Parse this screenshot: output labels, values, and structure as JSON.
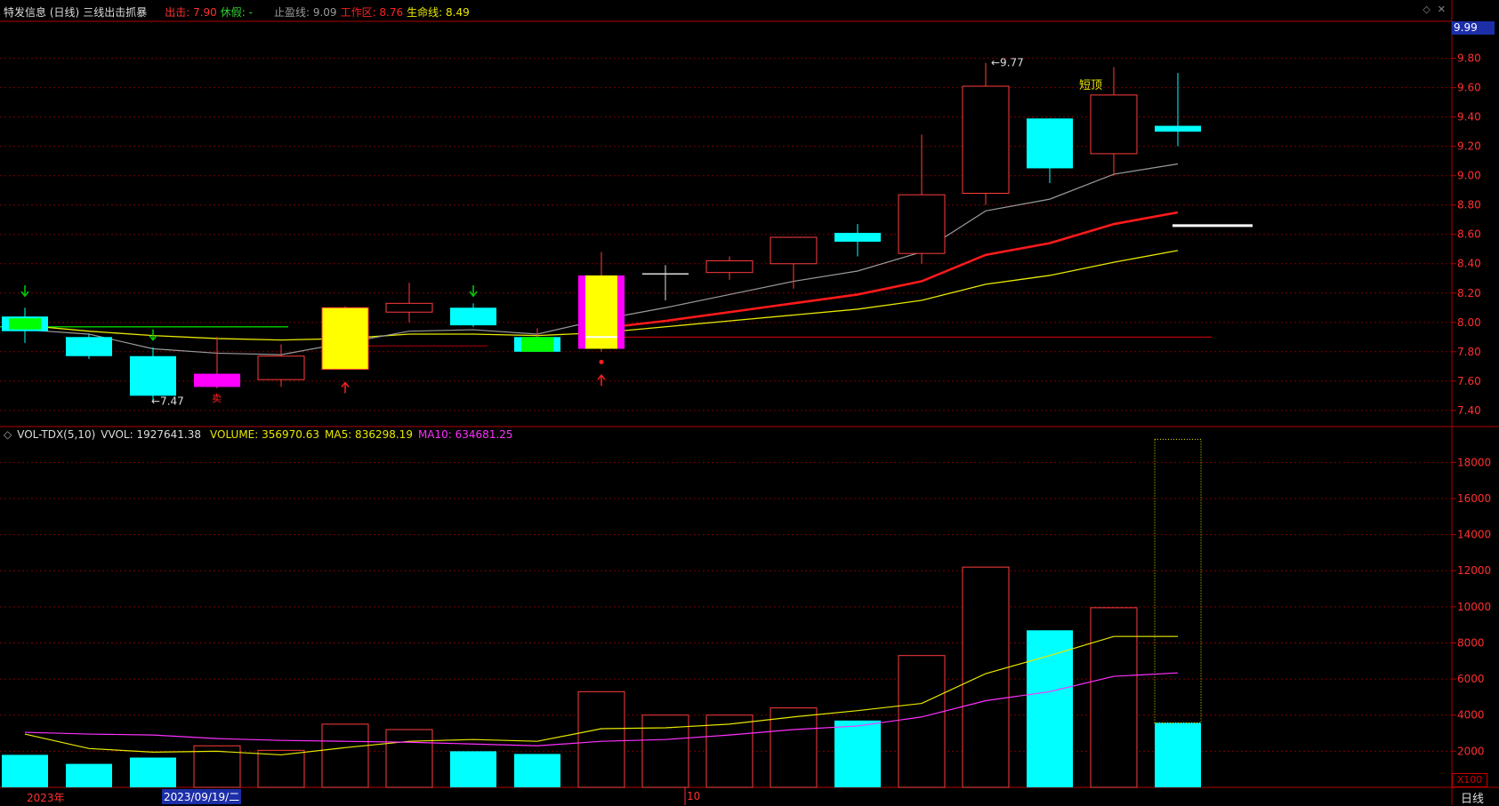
{
  "header": {
    "stock": "特发信息 (日线)",
    "indicator": "三线出击抓暴",
    "items": [
      {
        "label": "出击: 7.90",
        "color": "#ff3030"
      },
      {
        "label": "休假: -",
        "color": "#30d030"
      },
      {
        "label": "止盈线: 9.09",
        "color": "#9a9a9a"
      },
      {
        "label": "工作区: 8.76",
        "color": "#ff2020"
      },
      {
        "label": "生命线: 8.49",
        "color": "#e8e800"
      }
    ]
  },
  "window_icons": [
    "◇",
    "✕"
  ],
  "current_price_tag": "9.99",
  "annotations": {
    "high_label": "9.77",
    "low_label": "7.47",
    "short_top": "短顶",
    "sell_mark": "卖"
  },
  "volume_header": {
    "title": "VOL-TDX(5,10)",
    "vvol": "VVOL: 1927641.38",
    "volume": "VOLUME: 356970.63",
    "ma5": "MA5: 836298.19",
    "ma10": "MA10: 634681.25"
  },
  "volume_multiplier": "X100",
  "date_axis": {
    "year": "2023年",
    "cursor_date": "2023/09/19/二",
    "month": "10"
  },
  "period": "日线",
  "colors": {
    "up": "#ff3c3c",
    "down": "#00ffff",
    "yellow": "#ffff00",
    "magenta": "#ff00ff",
    "green": "#00ff00",
    "grid": "#7a0000"
  },
  "chart_data": {
    "type": "candlestick",
    "price_axis": {
      "ticks": [
        7.4,
        7.6,
        7.8,
        8.0,
        8.2,
        8.4,
        8.6,
        8.8,
        9.0,
        9.2,
        9.4,
        9.6,
        9.8
      ],
      "labels": [
        "7.40",
        "7.60",
        "7.80",
        "8.00",
        "8.20",
        "8.40",
        "8.60",
        "8.80",
        "9.00",
        "9.20",
        "9.40",
        "9.60",
        "9.80"
      ],
      "range": [
        7.29,
        10.04
      ]
    },
    "volume_axis": {
      "ticks": [
        2000,
        4000,
        6000,
        8000,
        10000,
        12000,
        14000,
        16000,
        18000
      ],
      "labels": [
        "2000",
        "4000",
        "6000",
        "8000",
        "10000",
        "12000",
        "14000",
        "16000",
        "18000"
      ],
      "range": [
        0,
        19100
      ]
    },
    "candles": [
      {
        "o": 8.04,
        "h": 8.1,
        "l": 7.86,
        "c": 7.94,
        "style": "down"
      },
      {
        "o": 7.9,
        "h": 7.92,
        "l": 7.75,
        "c": 7.77,
        "style": "down"
      },
      {
        "o": 7.77,
        "h": 7.83,
        "l": 7.47,
        "c": 7.5,
        "style": "down"
      },
      {
        "o": 7.56,
        "h": 7.9,
        "l": 7.55,
        "c": 7.65,
        "style": "magenta"
      },
      {
        "o": 7.61,
        "h": 7.85,
        "l": 7.56,
        "c": 7.77,
        "style": "up"
      },
      {
        "o": 7.68,
        "h": 8.11,
        "l": 7.68,
        "c": 8.1,
        "style": "yellow"
      },
      {
        "o": 8.07,
        "h": 8.27,
        "l": 8.0,
        "c": 8.13,
        "style": "up"
      },
      {
        "o": 8.1,
        "h": 8.13,
        "l": 7.97,
        "c": 7.98,
        "style": "down"
      },
      {
        "o": 7.9,
        "h": 7.96,
        "l": 7.8,
        "c": 7.8,
        "style": "green"
      },
      {
        "o": 7.82,
        "h": 8.48,
        "l": 7.8,
        "c": 8.32,
        "style": "yellow"
      },
      {
        "o": 8.33,
        "h": 8.39,
        "l": 8.15,
        "c": 8.33,
        "style": "doji"
      },
      {
        "o": 8.34,
        "h": 8.45,
        "l": 8.29,
        "c": 8.42,
        "style": "up"
      },
      {
        "o": 8.4,
        "h": 8.58,
        "l": 8.23,
        "c": 8.58,
        "style": "up"
      },
      {
        "o": 8.61,
        "h": 8.67,
        "l": 8.45,
        "c": 8.55,
        "style": "down"
      },
      {
        "o": 8.47,
        "h": 9.28,
        "l": 8.4,
        "c": 8.87,
        "style": "up"
      },
      {
        "o": 8.88,
        "h": 9.77,
        "l": 8.8,
        "c": 9.61,
        "style": "up"
      },
      {
        "o": 9.39,
        "h": 9.39,
        "l": 8.95,
        "c": 9.05,
        "style": "down"
      },
      {
        "o": 9.15,
        "h": 9.74,
        "l": 9.0,
        "c": 9.55,
        "style": "up"
      },
      {
        "o": 9.34,
        "h": 9.7,
        "l": 9.2,
        "c": 9.3,
        "style": "down"
      }
    ],
    "ma_gray": [
      7.95,
      7.92,
      7.82,
      7.79,
      7.78,
      7.86,
      7.94,
      7.95,
      7.92,
      8.02,
      8.1,
      8.19,
      8.28,
      8.35,
      8.48,
      8.76,
      8.84,
      9.01,
      9.08
    ],
    "ma_red": [
      null,
      null,
      null,
      null,
      null,
      null,
      null,
      null,
      null,
      7.96,
      8.01,
      8.07,
      8.13,
      8.19,
      8.28,
      8.46,
      8.54,
      8.67,
      8.75
    ],
    "ma_yellow": [
      7.98,
      7.94,
      7.91,
      7.89,
      7.88,
      7.89,
      7.92,
      7.92,
      7.91,
      7.93,
      7.97,
      8.01,
      8.05,
      8.09,
      8.15,
      8.26,
      8.32,
      8.41,
      8.49
    ],
    "volumes": [
      {
        "v": 1800,
        "style": "down"
      },
      {
        "v": 1300,
        "style": "down"
      },
      {
        "v": 1650,
        "style": "down"
      },
      {
        "v": 2300,
        "style": "up"
      },
      {
        "v": 2050,
        "style": "up"
      },
      {
        "v": 3500,
        "style": "up"
      },
      {
        "v": 3200,
        "style": "up"
      },
      {
        "v": 2000,
        "style": "down"
      },
      {
        "v": 1850,
        "style": "down"
      },
      {
        "v": 5300,
        "style": "up"
      },
      {
        "v": 4000,
        "style": "up"
      },
      {
        "v": 4000,
        "style": "up"
      },
      {
        "v": 4400,
        "style": "up"
      },
      {
        "v": 3700,
        "style": "down"
      },
      {
        "v": 7300,
        "style": "up"
      },
      {
        "v": 12200,
        "style": "up"
      },
      {
        "v": 8700,
        "style": "down"
      },
      {
        "v": 9950,
        "style": "up"
      },
      {
        "v": 3570,
        "style": "down"
      }
    ],
    "vvol": 19276,
    "vol_ma5": [
      2950,
      2150,
      1950,
      2000,
      1800,
      2200,
      2550,
      2650,
      2550,
      3250,
      3300,
      3500,
      3900,
      4250,
      4650,
      6300,
      7300,
      8360,
      8360
    ],
    "vol_ma10": [
      3050,
      2950,
      2900,
      2700,
      2600,
      2550,
      2500,
      2400,
      2300,
      2550,
      2650,
      2900,
      3200,
      3400,
      3900,
      4800,
      5300,
      6150,
      6340
    ]
  }
}
